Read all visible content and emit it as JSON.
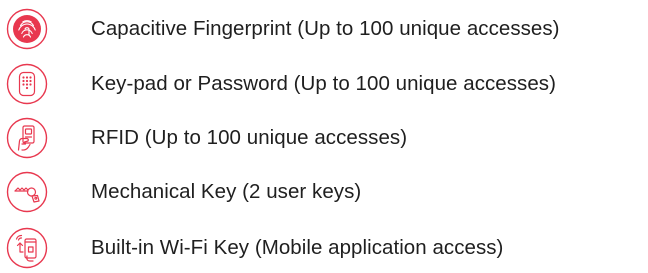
{
  "features": [
    {
      "icon": "fingerprint-icon",
      "label": "Capacitive Fingerprint (Up to 100 unique accesses)"
    },
    {
      "icon": "keypad-icon",
      "label": "Key-pad or Password (Up to 100 unique accesses)"
    },
    {
      "icon": "rfid-card-icon",
      "label": "RFID (Up to 100 unique accesses)"
    },
    {
      "icon": "mechanical-key-icon",
      "label": "Mechanical Key (2 user keys)"
    },
    {
      "icon": "wifi-phone-icon",
      "label": "Built-in Wi-Fi Key (Mobile application access)"
    }
  ],
  "colors": {
    "accent": "#e8384f",
    "text": "#1f1f1f"
  }
}
